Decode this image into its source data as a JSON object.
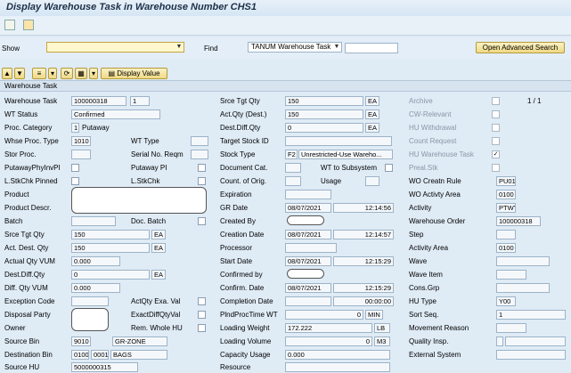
{
  "title": "Display Warehouse Task in Warehouse Number CHS1",
  "toolbar": {
    "show_label": "Show",
    "find_label": "Find",
    "find_select": "TANUM Warehouse Task",
    "open_adv": "Open Advanced Search",
    "display_value": "Display Value"
  },
  "section": "Warehouse Task",
  "page_counter": "1 / 1",
  "col1": {
    "wtask_label": "Warehouse Task",
    "wtask": "100000318",
    "wtask_item": "1",
    "wt_status_label": "WT Status",
    "wt_status": "Confirmed",
    "proc_cat_label": "Proc. Category",
    "proc_cat": "1",
    "proc_cat_text": "Putaway",
    "whse_proc_label": "Whse Proc. Type",
    "whse_proc": "1010",
    "stor_proc_label": "Stor Proc.",
    "putaway_label": "PutawayPhyInvPI",
    "lstk_pinned_label": "L.StkChk Pinned",
    "product_label": "Product",
    "product_descr_label": "Product Descr.",
    "batch_label": "Batch",
    "srce_tgt_qty_label": "Srce Tgt Qty",
    "srce_tgt_qty": "150",
    "srce_tgt_uom": "EA",
    "act_dest_qty_label": "Act. Dest. Qty",
    "act_dest_qty": "150",
    "act_dest_uom": "EA",
    "actual_vum_label": "Actual Qty VUM",
    "actual_vum": "0.000",
    "dest_diff_label": "Dest.Diff.Qty",
    "dest_diff": "0",
    "dest_diff_uom": "EA",
    "diff_vum_label": "Diff. Qty VUM",
    "diff_vum": "0.000",
    "exception_label": "Exception Code",
    "disposal_label": "Disposal Party",
    "owner_label": "Owner",
    "source_bin_label": "Source Bin",
    "source_bin_a": "9010",
    "source_bin_b": "GR-ZONE",
    "dest_bin_label": "Destination Bin",
    "dest_bin_a": "0100",
    "dest_bin_b": "0001",
    "dest_bin_c": "BAGS",
    "source_hu_label": "Source HU",
    "source_hu": "5000000315"
  },
  "col2": {
    "wt_type_label": "WT Type",
    "serial_label": "Serial No. Reqm",
    "putaway_pi_label": "Putaway PI",
    "lstkchk_label": "L.StkChk",
    "batch_label": "Doc. Batch",
    "actqty_exa_label": "ActQty Exa. Val",
    "exactdiff_label": "ExactDiffQtyVal",
    "rem_whole_label": "Rem. Whole HU"
  },
  "col3": {
    "srce_tgt_label": "Srce Tgt Qty",
    "srce_tgt": "150",
    "srce_tgt_uom": "EA",
    "act_qty_label": "Act.Qty (Dest.)",
    "act_qty": "150",
    "act_qty_uom": "EA",
    "dest_diff_label": "Dest.Diff.Qty",
    "dest_diff": "0",
    "dest_diff_uom": "EA",
    "target_stock_label": "Target Stock ID",
    "stock_type_label": "Stock Type",
    "stock_type": "F2",
    "stock_type_text": "Unrestricted-Use Wareho...",
    "document_cat_label": "Document Cat.",
    "wt_subsystem_label": "WT to Subsystem",
    "count_orig_label": "Count. of Orig.",
    "usage_label": "Usage",
    "expiration_label": "Expiration",
    "gr_date_label": "GR Date",
    "gr_date": "08/07/2021",
    "gr_time": "12:14:56",
    "created_by_label": "Created By",
    "creation_date_label": "Creation Date",
    "creation_date": "08/07/2021",
    "creation_time": "12:14:57",
    "processor_label": "Processor",
    "start_date_label": "Start Date",
    "start_date": "08/07/2021",
    "start_time": "12:15:29",
    "confirmed_by_label": "Confirmed by",
    "confirm_date_label": "Confirm. Date",
    "confirm_date": "08/07/2021",
    "confirm_time": "12:15:29",
    "completion_label": "Completion Date",
    "completion_time": "00:00:00",
    "phproc_label": "PlndProcTime WT",
    "phproc": "0",
    "phproc_uom": "MIN",
    "loading_weight_label": "Loading Weight",
    "loading_weight": "172.222",
    "loading_weight_uom": "LB",
    "loading_volume_label": "Loading Volume",
    "loading_volume": "0",
    "loading_volume_uom": "M3",
    "capacity_label": "Capacity Usage",
    "capacity": "0.000",
    "resource_label": "Resource"
  },
  "col4": {
    "archive_label": "Archive",
    "cw_label": "CW-Relevant",
    "hu_withdrawal_label": "HU Withdrawal",
    "count_request_label": "Count Request",
    "hu_wt_label": "HU Warehouse Task",
    "hu_wt_check": "✓",
    "prealstk_label": "Preal.Stk",
    "wo_rule_label": "WO Creatn Rule",
    "wo_rule": "PU01",
    "wo_area_label": "WO Activty Area",
    "wo_area": "0100",
    "activity_label": "Activity",
    "activity": "PTWY",
    "warehouse_order_label": "Warehouse Order",
    "warehouse_order": "100000318",
    "step_label": "Step",
    "activity_area_label": "Activity Area",
    "activity_area": "0100",
    "wave_label": "Wave",
    "wave_item_label": "Wave Item",
    "cons_grp_label": "Cons.Grp",
    "hu_type_label": "HU Type",
    "hu_type": "Y00",
    "sort_seq_label": "Sort Seq.",
    "sort_seq": "1",
    "movement_label": "Movement Reason",
    "quality_label": "Quality Insp.",
    "external_label": "External System"
  }
}
